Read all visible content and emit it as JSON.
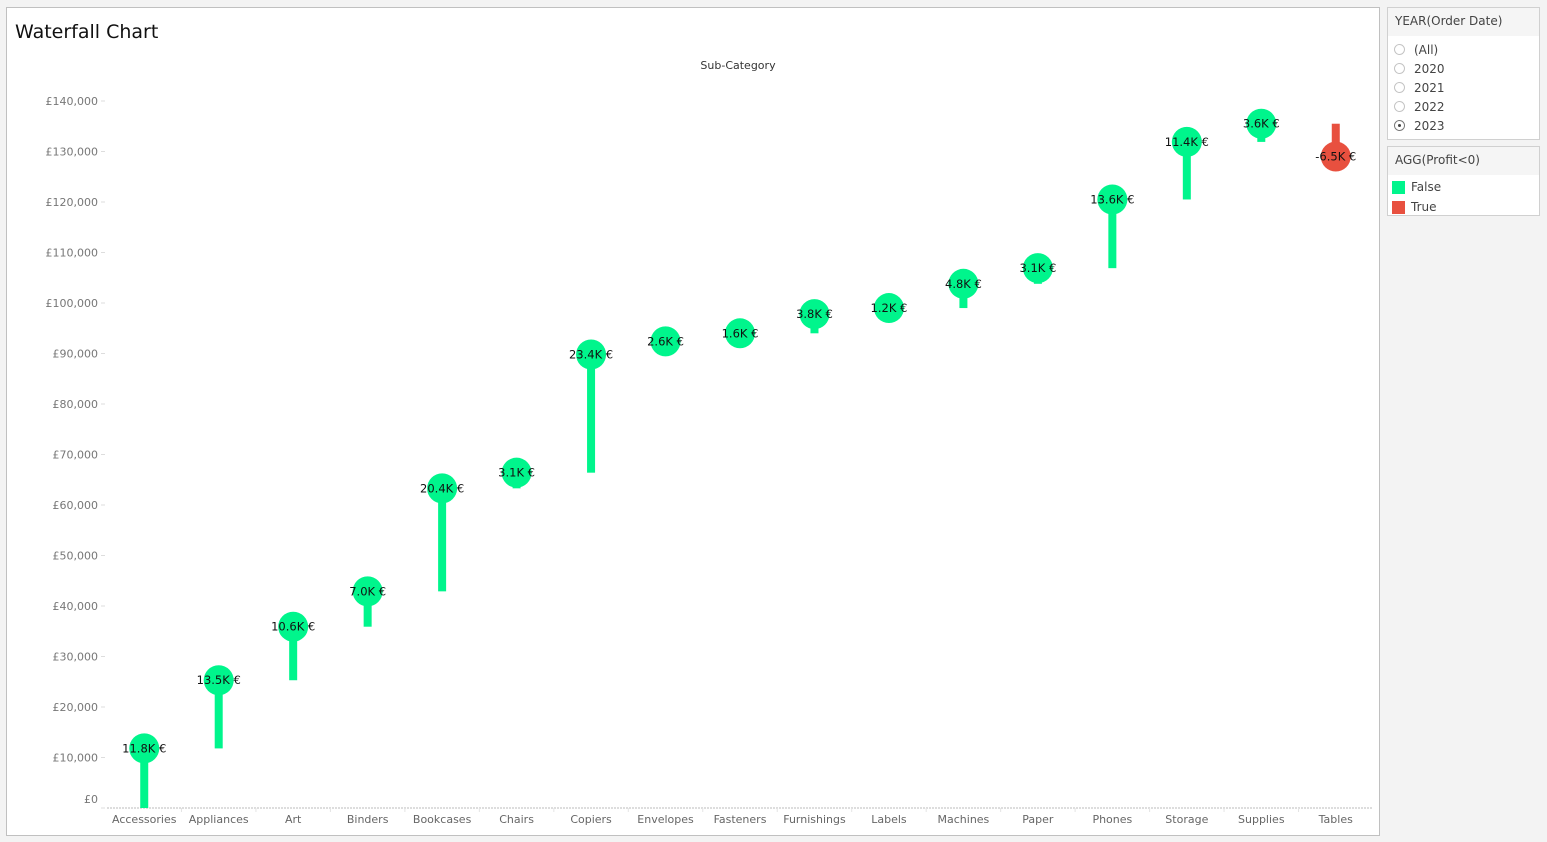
{
  "title": "Waterfall Chart",
  "filter": {
    "title": "YEAR(Order Date)",
    "options": [
      {
        "label": "(All)",
        "selected": false
      },
      {
        "label": "2020",
        "selected": false
      },
      {
        "label": "2021",
        "selected": false
      },
      {
        "label": "2022",
        "selected": false
      },
      {
        "label": "2023",
        "selected": true
      }
    ]
  },
  "legend": {
    "title": "AGG(Profit<0)",
    "items": [
      {
        "label": "False",
        "color": "#00f58c"
      },
      {
        "label": "True",
        "color": "#e8503f"
      }
    ]
  },
  "chart_data": {
    "type": "waterfall",
    "title": "Waterfall Chart",
    "xlabel": "Sub-Category",
    "ylabel": "",
    "ylim": [
      0,
      140000
    ],
    "yticks": [
      0,
      10000,
      20000,
      30000,
      40000,
      50000,
      60000,
      70000,
      80000,
      90000,
      100000,
      110000,
      120000,
      130000,
      140000
    ],
    "ytick_labels": [
      "£0",
      "£10,000",
      "£20,000",
      "£30,000",
      "£40,000",
      "£50,000",
      "£60,000",
      "£70,000",
      "£80,000",
      "£90,000",
      "£100,000",
      "£110,000",
      "£120,000",
      "£130,000",
      "£140,000"
    ],
    "categories": [
      "Accessories",
      "Appliances",
      "Art",
      "Binders",
      "Bookcases",
      "Chairs",
      "Copiers",
      "Envelopes",
      "Fasteners",
      "Furnishings",
      "Labels",
      "Machines",
      "Paper",
      "Phones",
      "Storage",
      "Supplies",
      "Tables"
    ],
    "values": [
      11800,
      13500,
      10600,
      7000,
      20400,
      3100,
      23400,
      2600,
      1600,
      3800,
      1200,
      4800,
      3100,
      13600,
      11400,
      3600,
      -6500
    ],
    "data_labels": [
      "11.8K €",
      "13.5K €",
      "10.6K €",
      "7.0K €",
      "20.4K €",
      "3.1K €",
      "23.4K €",
      "2.6K €",
      "1.6K €",
      "3.8K €",
      "1.2K €",
      "4.8K €",
      "3.1K €",
      "13.6K €",
      "11.4K €",
      "3.6K €",
      "-6.5K €"
    ],
    "color_rule": "Profit<0",
    "colors": {
      "positive": "#00f58c",
      "negative": "#e8503f"
    },
    "grid": false
  }
}
